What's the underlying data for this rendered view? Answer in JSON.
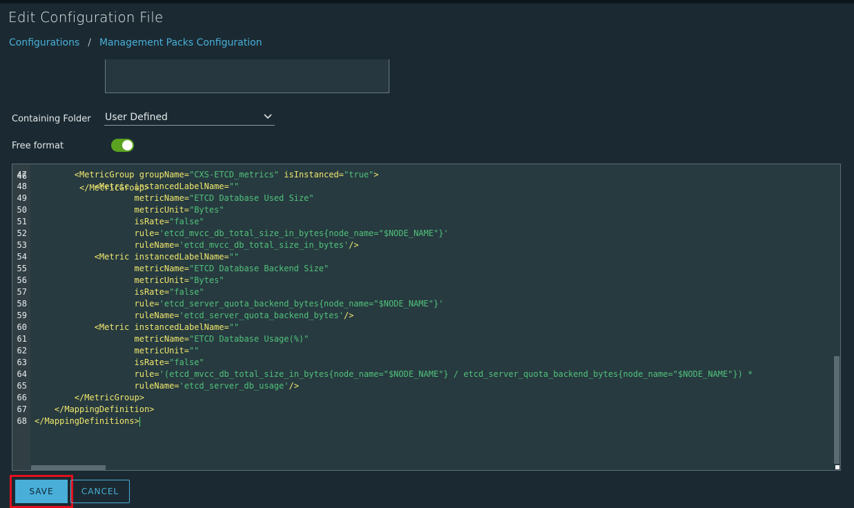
{
  "page": {
    "title": "Edit Configuration File"
  },
  "breadcrumb": {
    "items": [
      "Configurations",
      "Management Packs Configuration"
    ],
    "separator": "/"
  },
  "form": {
    "containing_folder_label": "Containing Folder",
    "containing_folder_value": "User Defined",
    "free_format_label": "Free format",
    "free_format_on": true
  },
  "editor": {
    "partial_line_number": "46",
    "partial_line_text": "</MetricGroup>",
    "line_numbers": [
      "47",
      "48",
      "49",
      "50",
      "51",
      "52",
      "53",
      "54",
      "55",
      "56",
      "57",
      "58",
      "59",
      "60",
      "61",
      "62",
      "63",
      "64",
      "65",
      "66",
      "67",
      "68"
    ],
    "lines": [
      "        <MetricGroup groupName=\"CXS-ETCD_metrics\" isInstanced=\"true\">",
      "            <Metric instancedLabelName=\"\"",
      "                    metricName=\"ETCD Database Used Size\"",
      "                    metricUnit=\"Bytes\"",
      "                    isRate=\"false\"",
      "                    rule='etcd_mvcc_db_total_size_in_bytes{node_name=\"$NODE_NAME\"}'",
      "                    ruleName='etcd_mvcc_db_total_size_in_bytes'/>",
      "            <Metric instancedLabelName=\"\"",
      "                    metricName=\"ETCD Database Backend Size\"",
      "                    metricUnit=\"Bytes\"",
      "                    isRate=\"false\"",
      "                    rule='etcd_server_quota_backend_bytes{node_name=\"$NODE_NAME\"}'",
      "                    ruleName='etcd_server_quota_backend_bytes'/>",
      "            <Metric instancedLabelName=\"\"",
      "                    metricName=\"ETCD Database Usage(%)\"",
      "                    metricUnit=\"\"",
      "                    isRate=\"false\"",
      "                    rule='(etcd_mvcc_db_total_size_in_bytes{node_name=\"$NODE_NAME\"} / etcd_server_quota_backend_bytes{node_name=\"$NODE_NAME\"}) *",
      "                    ruleName='etcd_server_db_usage'/>",
      "        </MetricGroup>",
      "    </MappingDefinition>",
      "</MappingDefinitions>"
    ]
  },
  "actions": {
    "save_label": "SAVE",
    "cancel_label": "CANCEL"
  },
  "colors": {
    "background": "#1b2a32",
    "link": "#49afd9",
    "primary_button": "#49afd9",
    "toggle_on": "#5aa220",
    "highlight_border": "#e3101c",
    "code_string": "#51c27a",
    "code_tag": "#f0e86c"
  }
}
